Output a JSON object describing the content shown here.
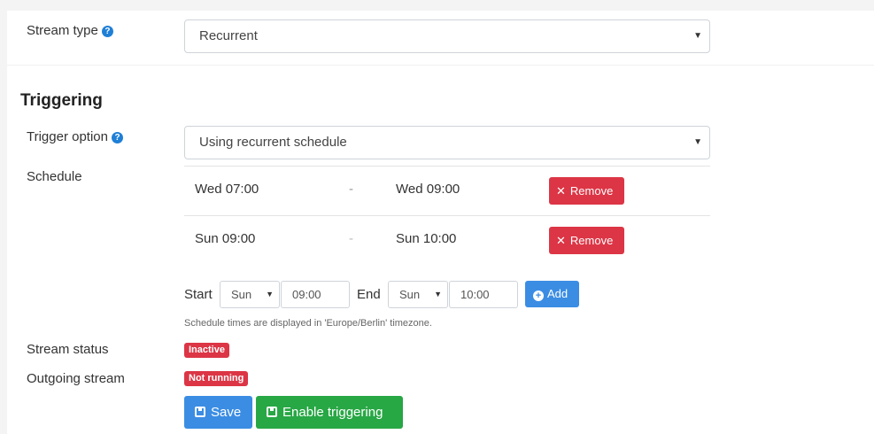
{
  "stream_type": {
    "label": "Stream type",
    "value": "Recurrent"
  },
  "triggering": {
    "title": "Triggering",
    "trigger_option": {
      "label": "Trigger option",
      "value": "Using recurrent schedule"
    },
    "schedule": {
      "label": "Schedule",
      "rows": [
        {
          "start": "Wed 07:00",
          "separator": "-",
          "end": "Wed 09:00",
          "remove_label": "Remove"
        },
        {
          "start": "Sun 09:00",
          "separator": "-",
          "end": "Sun 10:00",
          "remove_label": "Remove"
        }
      ],
      "new_entry": {
        "start_label": "Start",
        "start_day": "Sun",
        "start_time": "09:00",
        "end_label": "End",
        "end_day": "Sun",
        "end_time": "10:00",
        "add_label": "Add"
      },
      "timezone_note": "Schedule times are displayed in 'Europe/Berlin' timezone."
    }
  },
  "stream_status": {
    "label": "Stream status",
    "badge": "Inactive"
  },
  "outgoing_stream": {
    "label": "Outgoing stream",
    "badge": "Not running"
  },
  "actions": {
    "save_label": "Save",
    "enable_label": "Enable triggering"
  },
  "colors": {
    "primary": "#3b8de3",
    "success": "#28a745",
    "danger": "#dc3545",
    "help_icon": "#1f7fd6"
  },
  "icons": [
    "help-icon",
    "caret-down-icon",
    "close-icon",
    "plus-circle-icon",
    "floppy-disk-icon"
  ]
}
